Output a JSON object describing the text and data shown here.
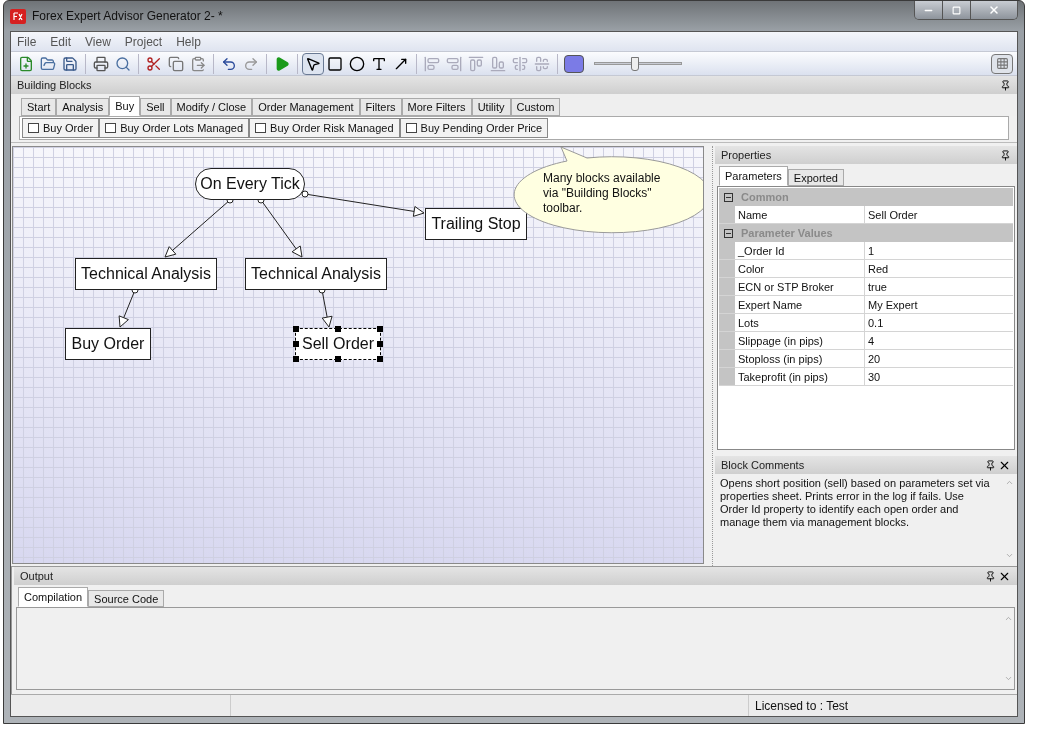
{
  "window": {
    "title": "Forex Expert Advisor Generator 2- *"
  },
  "menu": [
    "File",
    "Edit",
    "View",
    "Project",
    "Help"
  ],
  "drawing_tools": [
    {
      "kind": "pointer",
      "selected": true
    },
    {
      "kind": "rectangle",
      "selected": false
    },
    {
      "kind": "ellipse",
      "selected": false
    },
    {
      "kind": "text",
      "selected": false
    },
    {
      "kind": "connector",
      "selected": false
    }
  ],
  "zoom_slider": {
    "level": 0.47
  },
  "grid_toggle": {
    "on": true
  },
  "building_blocks": {
    "title": "Building Blocks",
    "tabs": [
      {
        "label": "Start",
        "selected": false
      },
      {
        "label": "Analysis",
        "selected": false
      },
      {
        "label": "Buy",
        "selected": true
      },
      {
        "label": "Sell",
        "selected": false
      },
      {
        "label": "Modify / Close",
        "selected": false
      },
      {
        "label": "Order Management",
        "selected": false
      },
      {
        "label": "Filters",
        "selected": false
      },
      {
        "label": "More Filters",
        "selected": false
      },
      {
        "label": "Utility",
        "selected": false
      },
      {
        "label": "Custom",
        "selected": false
      }
    ],
    "blocks": [
      "Buy Order",
      "Buy Order Lots Managed",
      "Buy Order Risk Managed",
      "Buy Pending Order Price"
    ]
  },
  "diagram": {
    "nodes": [
      {
        "label": "On Every Tick",
        "kind": "event",
        "selected": false,
        "children": [
          {
            "label": "Technical Analysis",
            "kind": "block",
            "selected": false,
            "children": [
              {
                "label": "Buy Order",
                "kind": "block",
                "selected": false
              }
            ]
          },
          {
            "label": "Technical Analysis",
            "kind": "block",
            "selected": false,
            "children": [
              {
                "label": "Sell Order",
                "kind": "block",
                "selected": true
              }
            ]
          },
          {
            "label": "Trailing Stop",
            "kind": "block",
            "selected": false
          }
        ]
      }
    ],
    "callout": "Many blocks available via \"Building Blocks\" toolbar."
  },
  "properties": {
    "title": "Properties",
    "tabs": [
      {
        "label": "Parameters",
        "selected": true
      },
      {
        "label": "Exported",
        "selected": false
      }
    ],
    "categories": [
      {
        "name": "Common",
        "expanded": true,
        "rows": [
          {
            "name": "Name",
            "value": "Sell Order"
          }
        ]
      },
      {
        "name": "Parameter Values",
        "expanded": true,
        "rows": [
          {
            "name": "_Order Id",
            "value": "1"
          },
          {
            "name": "Color",
            "value": "Red"
          },
          {
            "name": "ECN or STP Broker",
            "value": "true"
          },
          {
            "name": "Expert Name",
            "value": "My Expert"
          },
          {
            "name": "Lots",
            "value": "0.1"
          },
          {
            "name": "Slippage (in pips)",
            "value": "4"
          },
          {
            "name": "Stoploss (in pips)",
            "value": "20"
          },
          {
            "name": "Takeprofit (in pips)",
            "value": "30"
          }
        ]
      }
    ]
  },
  "block_comments": {
    "title": "Block Comments",
    "text": "Opens short position (sell) based on parameters set via properties sheet. Prints error in the log if fails. Use Order Id property to identify each open order and manage them via management blocks."
  },
  "output": {
    "title": "Output",
    "tabs": [
      {
        "label": "Compilation",
        "selected": true
      },
      {
        "label": "Source Code",
        "selected": false
      }
    ]
  },
  "status_bar": {
    "license": "Licensed to : Test"
  }
}
